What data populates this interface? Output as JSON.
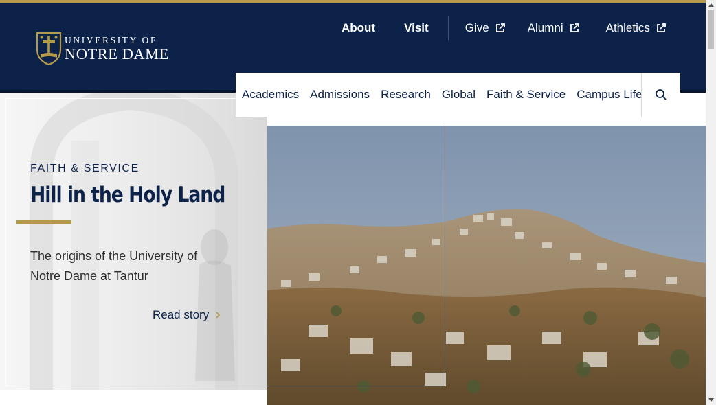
{
  "brand": {
    "line1": "UNIVERSITY OF",
    "line2": "NOTRE DAME",
    "navy": "#0c2249",
    "gold": "#b39a4b"
  },
  "utility_nav": [
    {
      "label": "About",
      "external": false
    },
    {
      "label": "Visit",
      "external": false
    },
    {
      "label": "Give",
      "external": true
    },
    {
      "label": "Alumni",
      "external": true
    },
    {
      "label": "Athletics",
      "external": true
    }
  ],
  "main_nav": [
    {
      "label": "Academics"
    },
    {
      "label": "Admissions"
    },
    {
      "label": "Research"
    },
    {
      "label": "Global"
    },
    {
      "label": "Faith & Service"
    },
    {
      "label": "Campus Life"
    }
  ],
  "search": {
    "icon": "search-icon"
  },
  "hero": {
    "kicker": "FAITH & SERVICE",
    "headline": "Hill in the Holy Land",
    "summary": "The origins of the University of Notre Dame at Tantur",
    "cta": "Read story"
  }
}
